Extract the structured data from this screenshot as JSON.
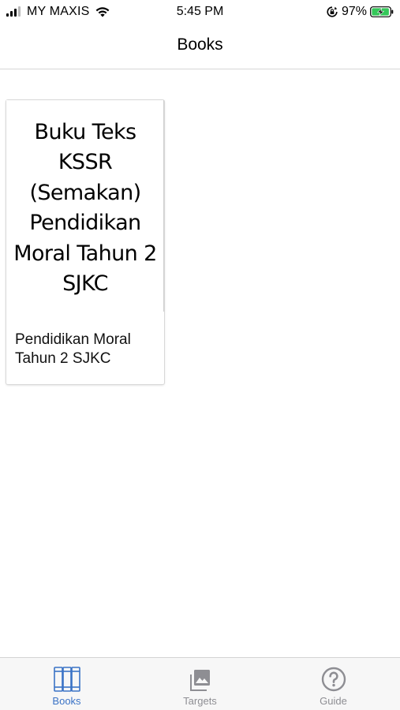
{
  "status_bar": {
    "carrier": "MY MAXIS",
    "time": "5:45 PM",
    "battery_percent": "97%",
    "signal_bars_active": 3,
    "signal_bars_total": 4,
    "battery_level": 0.97,
    "charging": true
  },
  "nav": {
    "title": "Books"
  },
  "books": [
    {
      "cover_text": "Buku Teks KSSR (Semakan) Pendidikan Moral Tahun 2 SJKC",
      "title": "Pendidikan Moral Tahun 2 SJKC"
    }
  ],
  "tabs": [
    {
      "label": "Books",
      "icon": "books-icon",
      "active": true
    },
    {
      "label": "Targets",
      "icon": "image-gallery-icon",
      "active": false
    },
    {
      "label": "Guide",
      "icon": "question-circle-icon",
      "active": false
    }
  ],
  "colors": {
    "accent": "#3b73c6",
    "inactive_tab": "#8e8e93",
    "battery_green": "#34c759"
  }
}
